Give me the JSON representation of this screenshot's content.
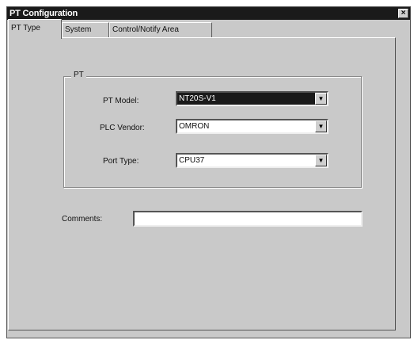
{
  "window": {
    "title": "PT Configuration",
    "close_label": "×"
  },
  "tabs": [
    {
      "label": "PT Type",
      "active": true
    },
    {
      "label": "System",
      "active": false
    },
    {
      "label": "Control/Notify Area",
      "active": false
    }
  ],
  "pt_group": {
    "legend": "PT",
    "pt_model": {
      "label": "PT Model:",
      "value": "NT20S-V1"
    },
    "plc_vendor": {
      "label": "PLC Vendor:",
      "value": "OMRON"
    },
    "port_type": {
      "label": "Port Type:",
      "value": "CPU37"
    }
  },
  "comments": {
    "label": "Comments:",
    "value": ""
  },
  "icons": {
    "dropdown": "chevron-down-icon",
    "close": "close-icon"
  }
}
